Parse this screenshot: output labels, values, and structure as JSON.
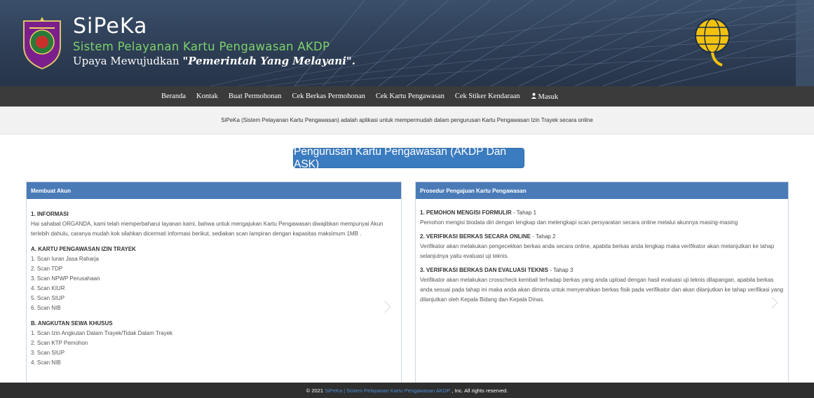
{
  "header": {
    "brand_title": "SiPeKa",
    "brand_subtitle": "Sistem Pelayanan Kartu Pengawasan AKDP",
    "motto_prefix": "Upaya Mewujudkan ",
    "motto_emphasis": "\"Pemerintah Yang Melayani\".",
    "colors": {
      "banner": "#2e3e55",
      "subtitle": "#7cd26b"
    }
  },
  "nav": {
    "items": [
      {
        "label": "Beranda"
      },
      {
        "label": "Kontak"
      },
      {
        "label": "Buat Permohonan"
      },
      {
        "label": "Cek Berkas Permohonan"
      },
      {
        "label": "Cek Kartu Pengawasan"
      },
      {
        "label": "Cek Stiker Kendaraan"
      },
      {
        "label": "Masuk",
        "icon": "user-icon"
      }
    ]
  },
  "intro": {
    "text": "SiPeKa (Sistem Pelayanan Kartu Pengawasan) adalah aplikasi untuk mempermudah dalam pengurusan Kartu Pengawasan Izin Trayek secara online"
  },
  "cta": {
    "label": "Pengurusan Kartu Pengawasan (AKDP Dan ASK)",
    "color": "#3b7bbf"
  },
  "left_panel": {
    "title": "Membuat Akun",
    "info_heading": "1. INFORMASI",
    "info_text": "Hai sahabat ORGANDA, kami telah memperbaharui layanan kami, bahwa untuk mengajukan Kartu Pengawasan diwajibkan mempunyai Akun terlebih dahulu, caranya mudah kok silahkan dicermati informasi berikut, sediakan scan lampiran dengan kapasitas maksimum 1MB .",
    "section_a": {
      "heading": "A. KARTU PENGAWASAN IZIN TRAYEK",
      "items": [
        "1. Scan Iuran Jasa Raharja",
        "2. Scan TDP",
        "3. Scan NPWP Perusahaan",
        "4. Scan KIUR",
        "5. Scan SIUP",
        "6. Scan NIB"
      ]
    },
    "section_b": {
      "heading": "B. ANGKUTAN SEWA KHUSUS",
      "items": [
        "1. Scan Izin Angkutan Dalam Trayek/Tidak Dalam Trayek",
        "2. Scan KTP Pemohon",
        "3. Scan SIUP",
        "4. Scan NIB"
      ]
    }
  },
  "right_panel": {
    "title": "Prosedur Pengajuan Kartu Pengawasan",
    "steps": [
      {
        "title": "1. PEMOHON MENGISI FORMULIR",
        "tag": " - Tahap 1",
        "text": "Pemohon mengisi biodata diri dengan lengkap dan melengkapi scan persyaratan secara online melalui akunnya masing-masing"
      },
      {
        "title": "2. VERIFIKASI BERKAS SECARA ONLINE",
        "tag": " - Tahap 2",
        "text": "Verifikator akan melakukan pengecekkan berkas anda secara online, apabila berkas anda lengkap maka verifikator akan melanjutkan ke tahap selanjutnya yaitu evaluasi uji teknis."
      },
      {
        "title": "3. VERIFIKASI BERKAS DAN EVALUASI TEKNIS",
        "tag": " - Tahap 3",
        "text": "Verifikator akan melakukan crosscheck kembali terhadap berkas yang anda upload dengan hasil evaluasi uji teknis dilapangan, apabila berkas anda sesuai pada tahap ini maka anda akan diminta untuk menyerahkan berkas fisik pada verifikator dan akan dilanjutkan ke tahap verifikasi yang dilanjutkan oleh Kepala Bidang dan Kepala Dinas."
      }
    ]
  },
  "footer": {
    "prefix": "© 2021 ",
    "link": "SiPeKa | Sistem Pelayanan Kartu Pengawasan AKDP",
    "suffix": ", Inc. All rights reserved."
  }
}
